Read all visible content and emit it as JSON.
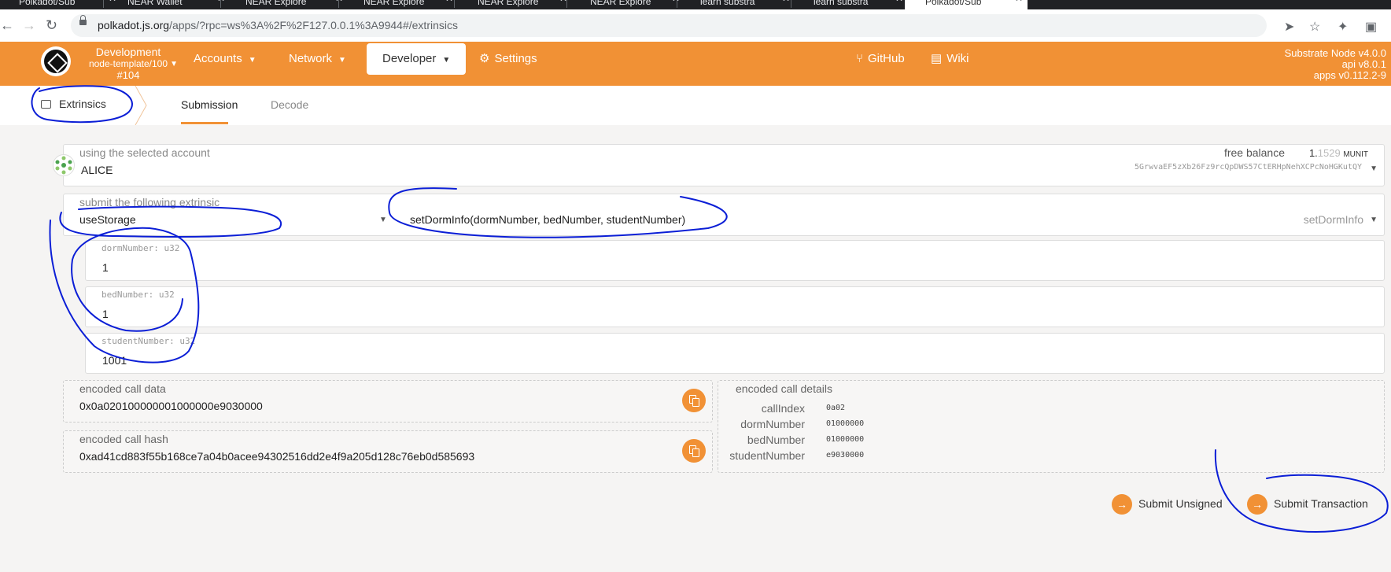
{
  "browser": {
    "tabs": [
      {
        "label": "Polkadot/Sub",
        "active": false
      },
      {
        "label": "NEAR Wallet",
        "active": false
      },
      {
        "label": "NEAR Explore",
        "active": false
      },
      {
        "label": "NEAR Explore",
        "active": false
      },
      {
        "label": "NEAR Explore",
        "active": false
      },
      {
        "label": "NEAR Explore",
        "active": false
      },
      {
        "label": "learn substra",
        "active": false
      },
      {
        "label": "learn substra",
        "active": false
      },
      {
        "label": "Polkadot/Sub",
        "active": true
      }
    ],
    "url_host": "polkadot.js.org",
    "url_path": "/apps/?rpc=ws%3A%2F%2F127.0.0.1%3A9944#/extrinsics"
  },
  "header": {
    "chain_name": "Development",
    "chain_version": "node-template/100",
    "block": "#104",
    "menu": {
      "accounts": "Accounts",
      "network": "Network",
      "developer": "Developer",
      "settings": "Settings",
      "github": "GitHub",
      "wiki": "Wiki"
    },
    "version_lines": [
      "Substrate Node v4.0.0",
      "api v8.0.1",
      "apps v0.112.2-9"
    ]
  },
  "subnav": {
    "section": "Extrinsics",
    "tabs": [
      "Submission",
      "Decode"
    ]
  },
  "account": {
    "label": "using the selected account",
    "name": "ALICE",
    "free_balance_label": "free balance",
    "balance_int": "1.",
    "balance_dec": "1529",
    "balance_unit": "MUNIT",
    "address": "5GrwvaEF5zXb26Fz9rcQpDWS57CtERHpNehXCPcNoHGKutQY"
  },
  "extrinsic": {
    "label": "submit the following extrinsic",
    "pallet": "useStorage",
    "call_signature": "setDormInfo(dormNumber, bedNumber, studentNumber)",
    "method": "setDormInfo"
  },
  "params": [
    {
      "label": "dormNumber: u32",
      "value": "1"
    },
    {
      "label": "bedNumber: u32",
      "value": "1"
    },
    {
      "label": "studentNumber: u32",
      "value": "1001"
    }
  ],
  "encoded": {
    "call_data_label": "encoded call data",
    "call_data": "0x0a020100000001000000e9030000",
    "call_hash_label": "encoded call hash",
    "call_hash": "0xad41cd883f55b168ce7a04b0acee94302516dd2e4f9a205d128c76eb0d585693",
    "details_label": "encoded call details",
    "details": [
      {
        "key": "callIndex",
        "value": "0a02"
      },
      {
        "key": "dormNumber",
        "value": "01000000"
      },
      {
        "key": "bedNumber",
        "value": "01000000"
      },
      {
        "key": "studentNumber",
        "value": "e9030000"
      }
    ]
  },
  "actions": {
    "submit_unsigned": "Submit Unsigned",
    "submit_transaction": "Submit Transaction"
  },
  "colors": {
    "accent": "#f19135",
    "annotation": "#0b1ed6"
  }
}
